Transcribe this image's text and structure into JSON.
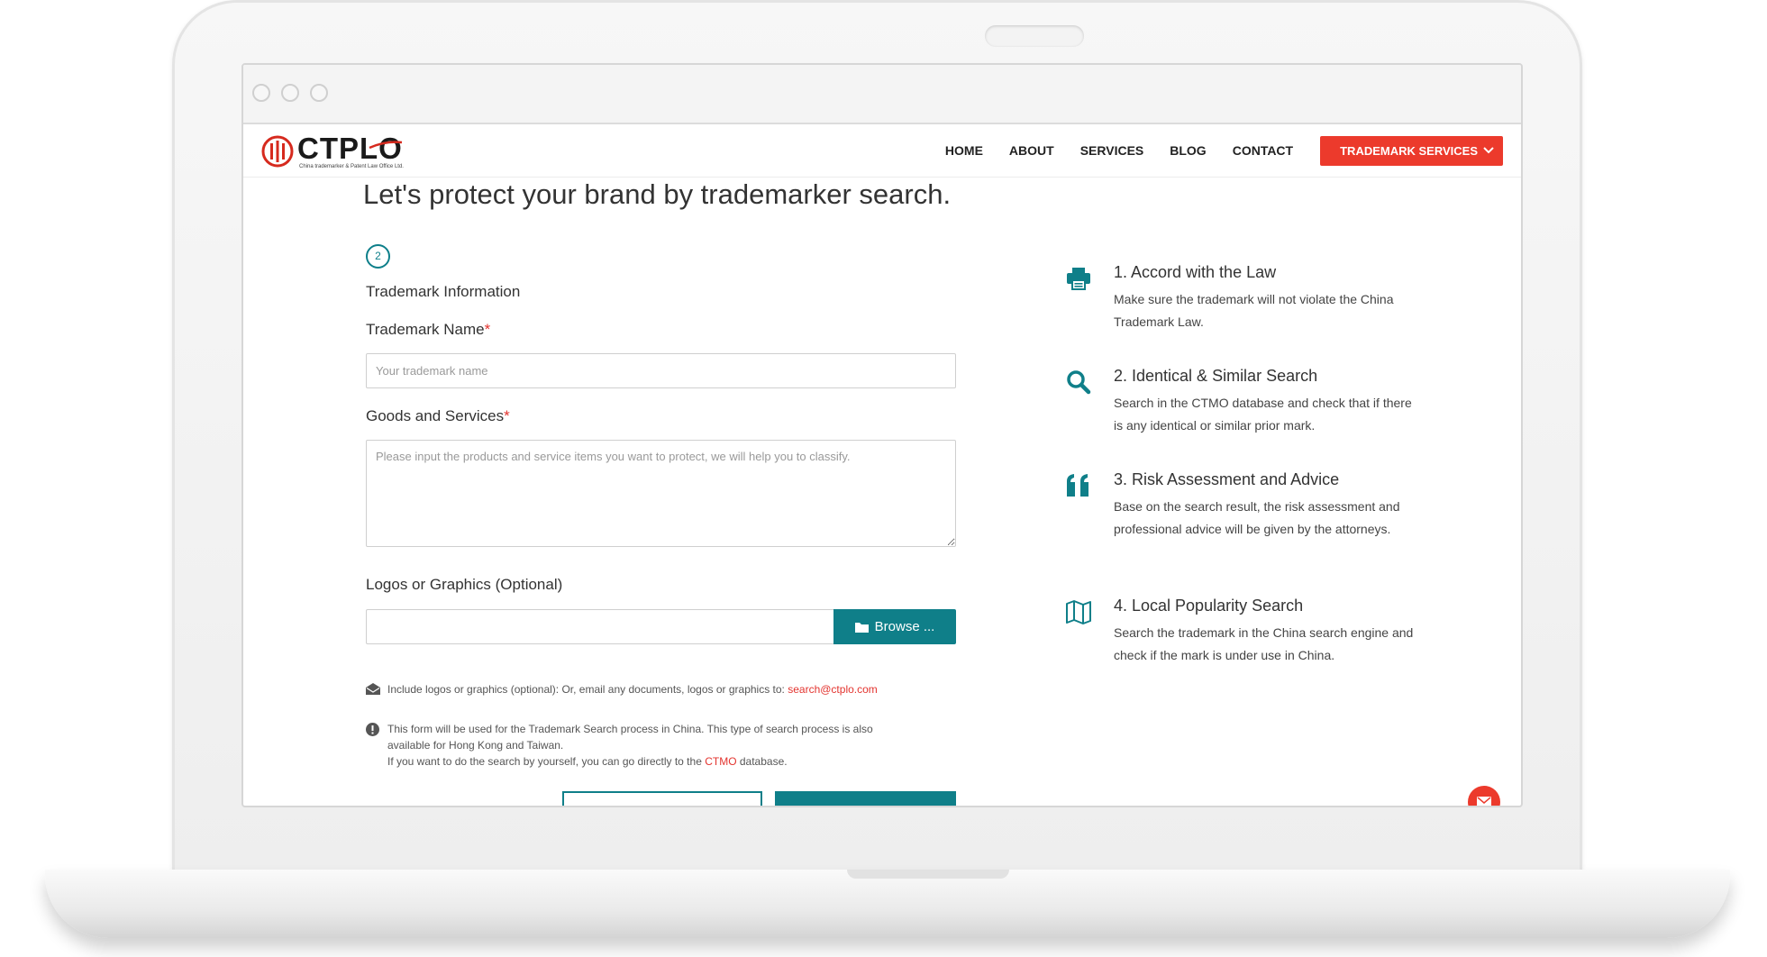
{
  "header": {
    "logo_text": "CTPLO",
    "logo_subtitle": "China trademarker & Patent Law Office Ltd.",
    "nav": [
      "HOME",
      "ABOUT",
      "SERVICES",
      "BLOG",
      "CONTACT"
    ],
    "cta_label": "TRADEMARK SERVICES"
  },
  "main": {
    "headline": "Let's protect your brand by trademarker search.",
    "step_number": "2",
    "section_title": "Trademark Information",
    "trademark_name": {
      "label": "Trademark Name",
      "required_mark": "*",
      "placeholder": "Your trademark name",
      "value": ""
    },
    "goods_services": {
      "label": "Goods and Services",
      "required_mark": "*",
      "placeholder": "Please input the products and service items you want to protect, we will help you to classify.",
      "value": ""
    },
    "logos": {
      "label": "Logos or Graphics (Optional)",
      "browse_label": "Browse ..."
    },
    "email_note": {
      "text": "Include logos or graphics (optional): Or, email any documents, logos or graphics to: ",
      "email": "search@ctplo.com"
    },
    "info_note": {
      "line1": "This form will be used for the Trademark Search process in China. This type of search process is also",
      "line2": "available for Hong Kong and Taiwan.",
      "line3_prefix": "If you want to do the search by yourself, you can go directly to the ",
      "line3_link": "CTMO",
      "line3_suffix": " database."
    }
  },
  "features": [
    {
      "icon": "printer-icon",
      "title": "1. Accord with the Law",
      "desc": "Make sure the trademark will not violate the China Trademark Law."
    },
    {
      "icon": "search-icon",
      "title": "2. Identical & Similar Search",
      "desc": "Search in the CTMO database and check that if there is any identical or similar prior mark."
    },
    {
      "icon": "quote-icon",
      "title": "3. Risk Assessment and Advice",
      "desc": "Base on the search result, the risk assessment and professional advice will be given by the attorneys."
    },
    {
      "icon": "map-icon",
      "title": "4. Local Popularity Search",
      "desc": "Search the trademark in the China search engine and check if the mark is under use in China."
    }
  ],
  "colors": {
    "accent_red": "#ec3a2c",
    "accent_teal": "#0f7f89",
    "text": "#333333"
  }
}
